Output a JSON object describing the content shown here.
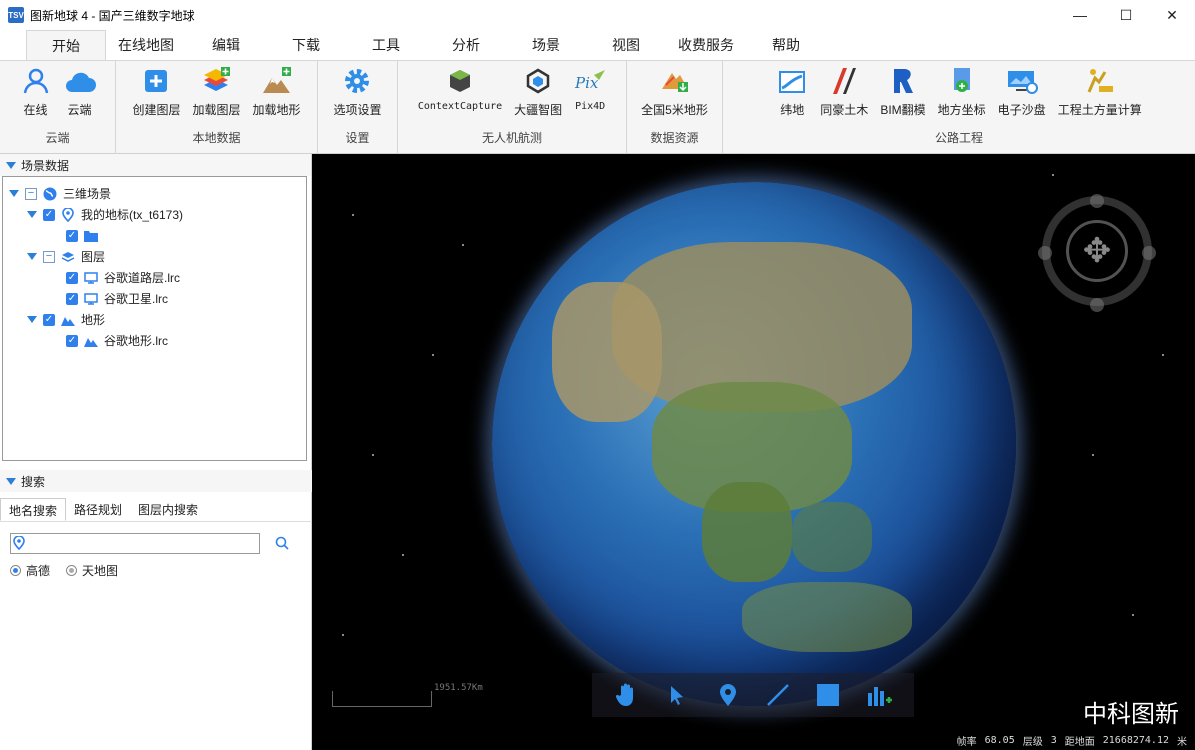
{
  "window": {
    "title": "图新地球 4 - 国产三维数字地球",
    "app_icon_text": "TSV"
  },
  "menu": {
    "tabs": [
      "开始",
      "在线地图",
      "编辑",
      "下载",
      "工具",
      "分析",
      "场景",
      "视图",
      "收费服务",
      "帮助"
    ],
    "active": "开始"
  },
  "ribbon": {
    "groups": [
      {
        "label": "云端",
        "buttons": [
          "在线",
          "云端"
        ]
      },
      {
        "label": "本地数据",
        "buttons": [
          "创建图层",
          "加载图层",
          "加载地形"
        ]
      },
      {
        "label": "设置",
        "buttons": [
          "选项设置"
        ]
      },
      {
        "label": "无人机航测",
        "buttons": [
          "ContextCapture",
          "大疆智图",
          "Pix4D"
        ]
      },
      {
        "label": "数据资源",
        "buttons": [
          "全国5米地形"
        ]
      },
      {
        "label": "公路工程",
        "buttons": [
          "纬地",
          "同豪土木",
          "BIM翻模",
          "地方坐标",
          "电子沙盘",
          "工程土方量计算"
        ]
      }
    ]
  },
  "left": {
    "scene_header": "场景数据",
    "tree": [
      {
        "label": "三维场景",
        "level": 0
      },
      {
        "label": "我的地标(tx_t6173)",
        "level": 1
      },
      {
        "label": "",
        "level": 2
      },
      {
        "label": "图层",
        "level": 1
      },
      {
        "label": "谷歌道路层.lrc",
        "level": 2
      },
      {
        "label": "谷歌卫星.lrc",
        "level": 2
      },
      {
        "label": "地形",
        "level": 1
      },
      {
        "label": "谷歌地形.lrc",
        "level": 2
      }
    ],
    "search_header": "搜索",
    "search_tabs": [
      "地名搜索",
      "路径规划",
      "图层内搜索"
    ],
    "search_value": "",
    "radios": [
      {
        "label": "高德",
        "checked": true
      },
      {
        "label": "天地图",
        "checked": false
      }
    ]
  },
  "viewport": {
    "scale_text": "1951.57Km",
    "watermark": "中科图新",
    "status": {
      "fps_label": "帧率",
      "fps": "68.05",
      "level_label": "层级",
      "level": "3",
      "dist_label": "距地面",
      "dist": "21668274.12",
      "unit": "米"
    }
  },
  "colors": {
    "accent": "#2f80ed",
    "ribbon_bg": "#f5f5f5"
  }
}
